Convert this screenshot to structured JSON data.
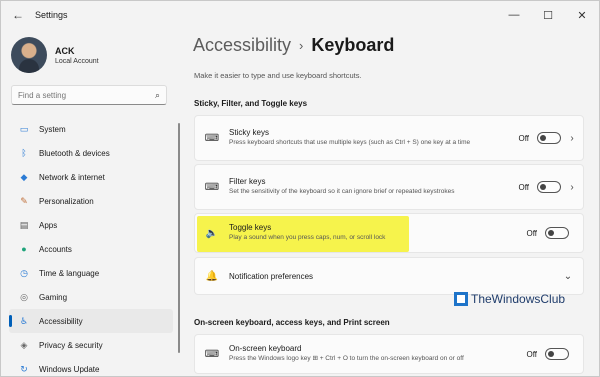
{
  "window": {
    "title": "Settings"
  },
  "profile": {
    "name": "ACK",
    "account_type": "Local Account"
  },
  "search": {
    "placeholder": "Find a setting"
  },
  "sidebar": {
    "items": [
      {
        "label": "System",
        "icon": "system-icon",
        "glyph": "▭",
        "color": "#2b7bd4"
      },
      {
        "label": "Bluetooth & devices",
        "icon": "bluetooth-icon",
        "glyph": "ᛒ",
        "color": "#2b7bd4"
      },
      {
        "label": "Network & internet",
        "icon": "wifi-icon",
        "glyph": "◆",
        "color": "#2b7bd4"
      },
      {
        "label": "Personalization",
        "icon": "brush-icon",
        "glyph": "✎",
        "color": "#c0703a"
      },
      {
        "label": "Apps",
        "icon": "apps-icon",
        "glyph": "▤",
        "color": "#555555"
      },
      {
        "label": "Accounts",
        "icon": "person-icon",
        "glyph": "●",
        "color": "#1fa37a"
      },
      {
        "label": "Time & language",
        "icon": "clock-icon",
        "glyph": "◷",
        "color": "#2b7bd4"
      },
      {
        "label": "Gaming",
        "icon": "controller-icon",
        "glyph": "◎",
        "color": "#666666"
      },
      {
        "label": "Accessibility",
        "icon": "accessibility-icon",
        "glyph": "♿",
        "color": "#2b7bd4",
        "active": true
      },
      {
        "label": "Privacy & security",
        "icon": "shield-icon",
        "glyph": "◈",
        "color": "#666666"
      },
      {
        "label": "Windows Update",
        "icon": "refresh-icon",
        "glyph": "↻",
        "color": "#2b7bd4"
      }
    ]
  },
  "breadcrumb": {
    "parent": "Accessibility",
    "separator": "›",
    "current": "Keyboard"
  },
  "subtitle": "Make it easier to type and use keyboard shortcuts.",
  "sections": [
    {
      "title": "Sticky, Filter, and Toggle keys"
    },
    {
      "title": "On-screen keyboard, access keys, and Print screen"
    }
  ],
  "cards": [
    {
      "title": "Sticky keys",
      "desc": "Press keyboard shortcuts that use multiple keys (such as Ctrl + S) one key at a time",
      "state": "Off",
      "icon": "keyboard-icon",
      "glyph": "⌨",
      "has_chevron": true
    },
    {
      "title": "Filter keys",
      "desc": "Set the sensitivity of the keyboard so it can ignore brief or repeated keystrokes",
      "state": "Off",
      "icon": "keyboard-timer-icon",
      "glyph": "⌨",
      "has_chevron": true
    },
    {
      "title": "Toggle keys",
      "desc": "Play a sound when you press caps, num, or scroll lock",
      "state": "Off",
      "icon": "speaker-icon",
      "glyph": "🔈",
      "highlighted": true,
      "highlight_color": "#f6f34c"
    },
    {
      "title": "Notification preferences",
      "icon": "bell-icon",
      "glyph": "🔔",
      "expandable": true
    },
    {
      "title": "On-screen keyboard",
      "desc": "Press the Windows logo key ⊞ + Ctrl + O to turn the on-screen keyboard on or off",
      "state": "Off",
      "icon": "onscreen-keyboard-icon",
      "glyph": "⌨"
    }
  ],
  "watermark": {
    "text": "TheWindowsClub"
  },
  "colors": {
    "accent": "#005fb8",
    "background": "#f3f3f3",
    "card": "#fbfbfb"
  }
}
